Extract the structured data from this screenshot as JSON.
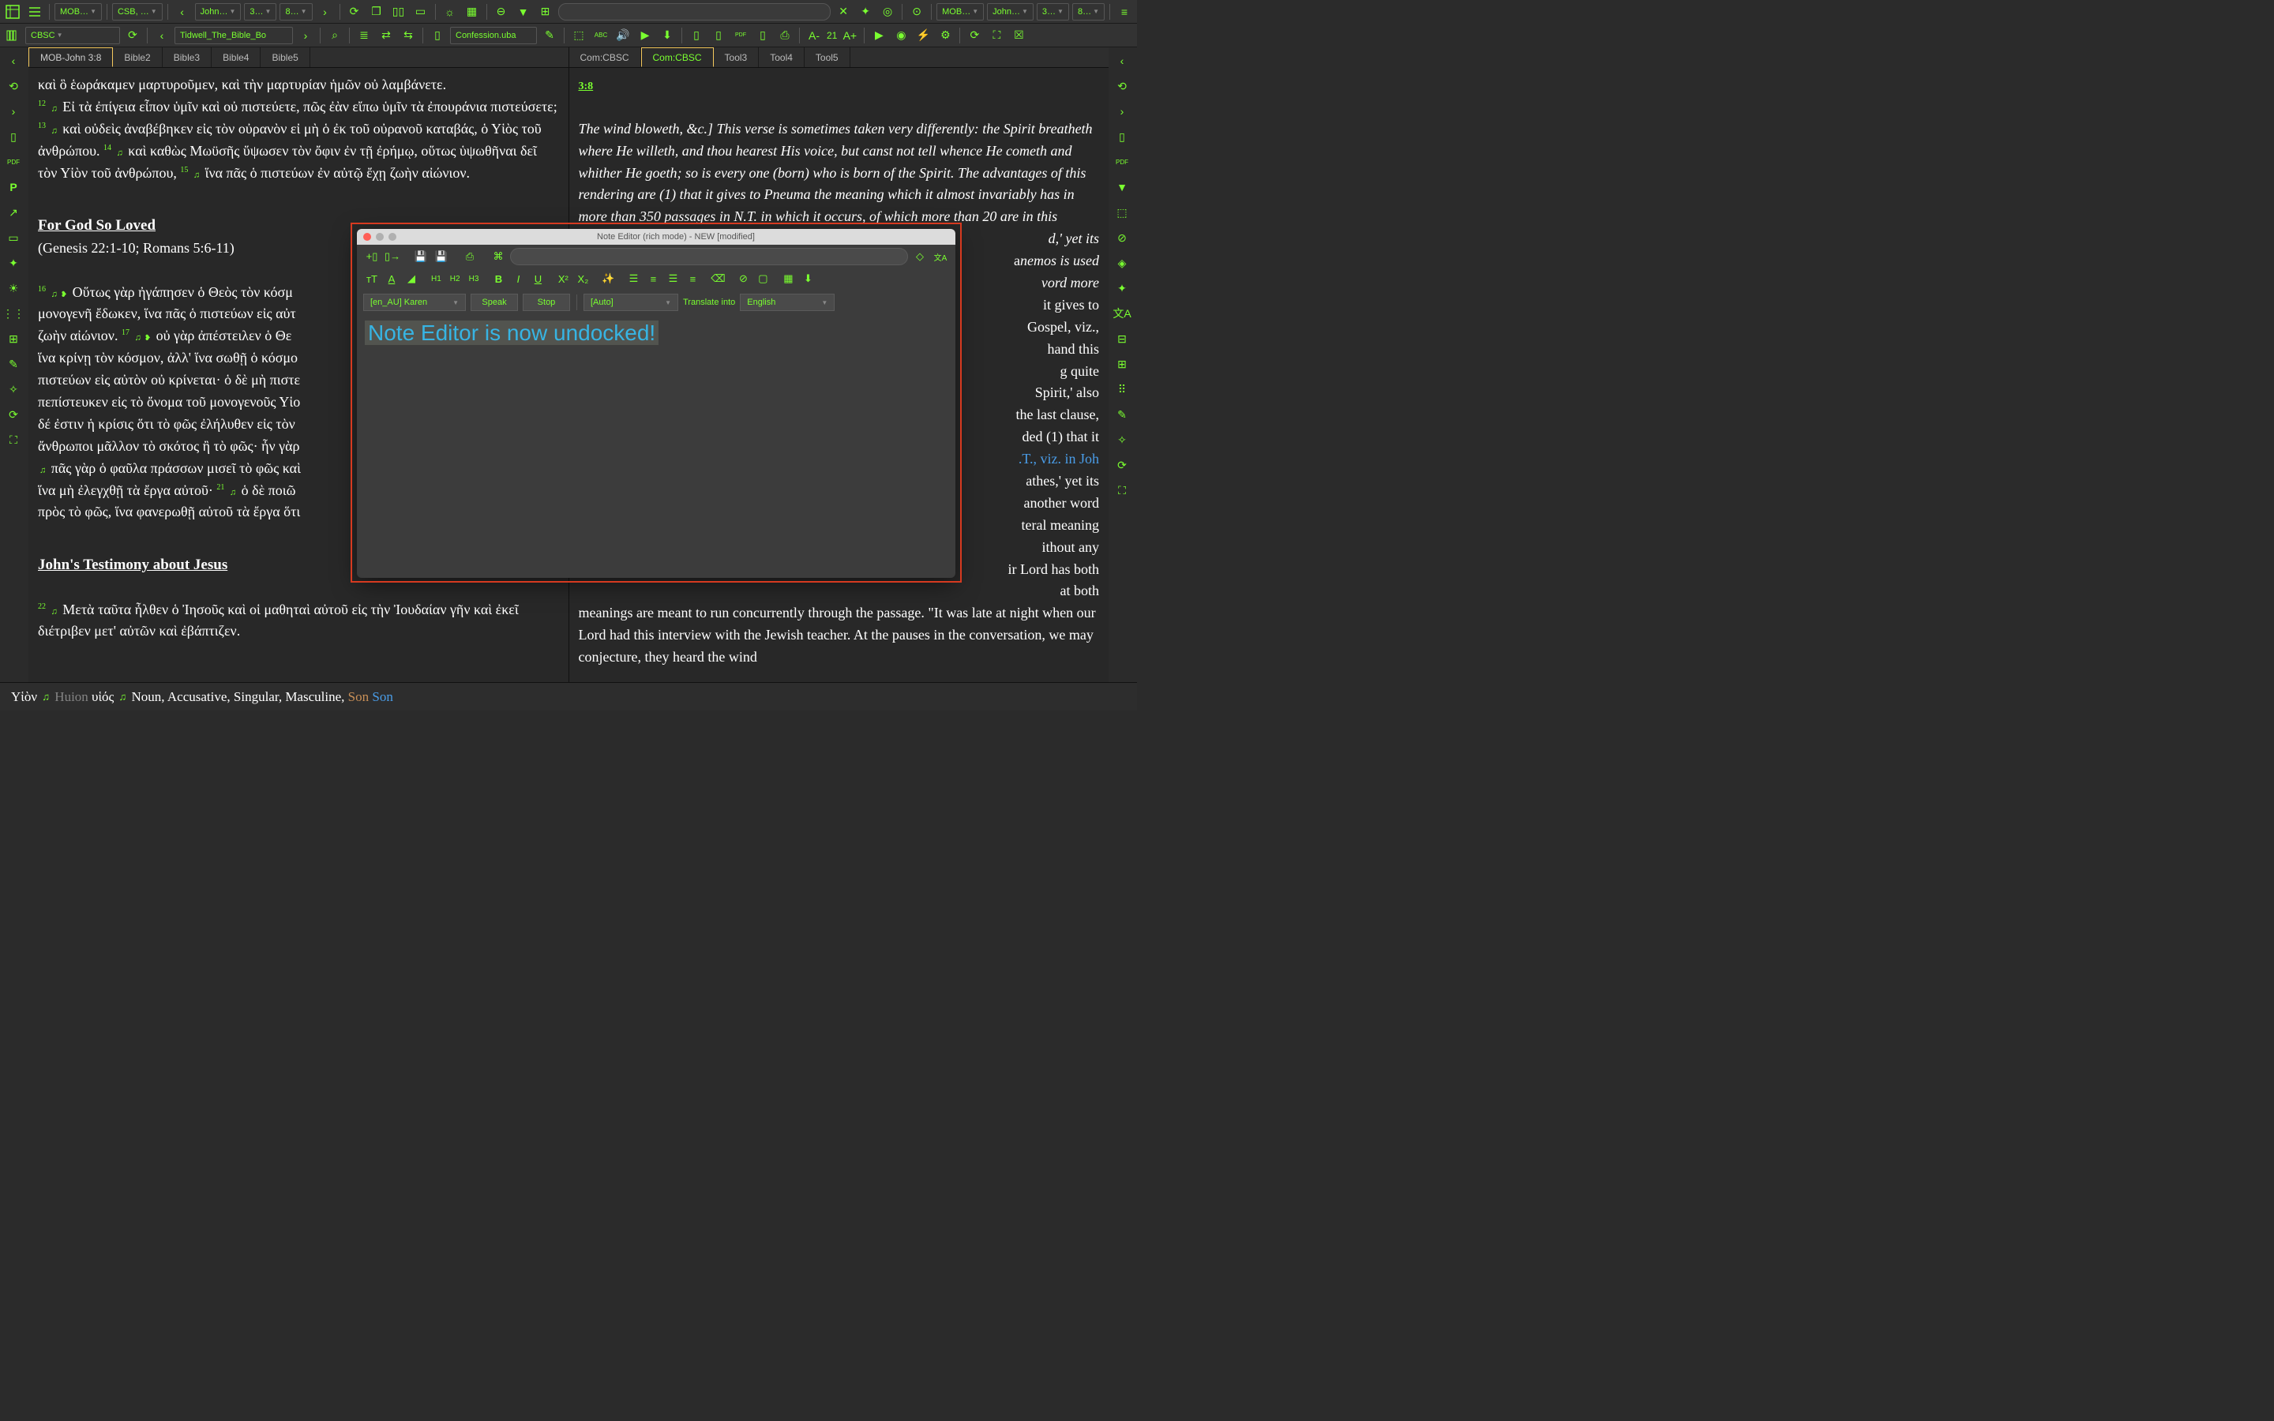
{
  "top": {
    "module1": "MOB…",
    "module2": "CSB, …",
    "nav_book": "John…",
    "nav_chap": "3…",
    "nav_verse": "8…",
    "right_mod": "MOB…",
    "right_book": "John…",
    "right_chap": "3…",
    "right_verse": "8…"
  },
  "second": {
    "dropdown": "CBSC",
    "book_file": "Tidwell_The_Bible_Bo",
    "file": "Confession.uba",
    "zoom": "21"
  },
  "left_tabs": [
    "MOB-John 3:8",
    "Bible2",
    "Bible3",
    "Bible4",
    "Bible5"
  ],
  "right_tabs": [
    "Com:CBSC",
    "Com:CBSC",
    "Tool3",
    "Tool4",
    "Tool5"
  ],
  "left_content": {
    "greek1": "καὶ ὃ ἑωράκαμεν μαρτυροῦμεν, καὶ τὴν μαρτυρίαν ἡμῶν οὐ λαμβάνετε.",
    "v12": "12",
    "greek2": "Εἰ τὰ ἐπίγεια εἶπον ὑμῖν καὶ οὐ πιστεύετε, πῶς ἐὰν εἴπω ὑμῖν τὰ ἐπουράνια πιστεύσετε;",
    "v13": "13",
    "greek3": "καὶ οὐδεὶς ἀναβέβηκεν εἰς τὸν οὐρανὸν εἰ μὴ ὁ ἐκ τοῦ οὐρανοῦ καταβάς, ὁ Υἱὸς τοῦ ἀνθρώπου.",
    "v14": "14",
    "greek4": "καὶ καθὼς Μωϋσῆς ὕψωσεν τὸν ὄφιν ἐν τῇ ἐρήμῳ, οὕτως ὑψωθῆναι δεῖ τὸν Υἱὸν τοῦ ἀνθρώπου,",
    "v15": "15",
    "greek5": "ἵνα πᾶς ὁ πιστεύων ἐν αὐτῷ ἔχῃ ζωὴν αἰώνιον.",
    "heading1": "For God So Loved",
    "xrefs": "(Genesis 22:1-10; Romans 5:6-11)",
    "v16": "16",
    "greek6": "Οὕτως γὰρ ἠγάπησεν ὁ Θεὸς τὸν κόσμ",
    "greek6b": "μονογενῆ ἔδωκεν, ἵνα πᾶς ὁ πιστεύων εἰς αὐτ",
    "greek6c": "ζωὴν αἰώνιον.",
    "v17": "17",
    "greek7": "οὐ γὰρ ἀπέστειλεν ὁ Θε",
    "greek7b": "ἵνα κρίνῃ τὸν κόσμον, ἀλλ' ἵνα σωθῇ ὁ κόσμο",
    "greek7c": "πιστεύων εἰς αὐτὸν οὐ κρίνεται· ὁ δὲ μὴ πιστε",
    "greek7d": "πεπίστευκεν εἰς τὸ ὄνομα τοῦ μονογενοῦς Υἱο",
    "greek7e": "δέ ἐστιν ἡ κρίσις ὅτι τὸ φῶς ἐλήλυθεν εἰς τὸν",
    "greek7f": "ἄνθρωποι μᾶλλον τὸ σκότος ἢ τὸ φῶς· ἦν γὰρ",
    "greek8": "πᾶς γὰρ ὁ φαῦλα πράσσων μισεῖ τὸ φῶς καὶ",
    "greek8b": "ἵνα μὴ ἐλεγχθῇ τὰ ἔργα αὐτοῦ·",
    "v21": "21",
    "greek9": "ὁ δὲ ποιῶ",
    "greek9b": "πρὸς τὸ φῶς, ἵνα φανερωθῇ αὐτοῦ τὰ ἔργα ὅτι",
    "heading2": "John's Testimony about Jesus",
    "v22": "22",
    "greek10": "Μετὰ ταῦτα ἦλθεν ὁ Ἰησοῦς καὶ οἱ μαθηταὶ αὐτοῦ εἰς τὴν Ἰουδαίαν γῆν καὶ ἐκεῖ διέτριβεν μετ' αὐτῶν καὶ ἐβάπτιζεν."
  },
  "right_content": {
    "ref": "3:8",
    "para": "The wind bloweth, &c.] This verse is sometimes taken very differently: the Spirit breatheth where He willeth, and thou hearest His voice, but canst not tell whence He cometh and whither He goeth; so is every one (born) who is born of the Spirit. The advantages of this rendering are (1) that it gives to Pneuma the meaning which it almost invariably has in more than 350 passages in N.T. in which it occurs, of which more than 20 are in this",
    "para_cont_a": "d,' yet its",
    "para_cont_b": "nemos is used",
    "para_cont_c": "vord more",
    "para_cont_d": "it gives to",
    "para_cont_e": "Gospel, viz.,",
    "para_cont_f": "hand this",
    "para_cont_g": "g quite",
    "para_cont_h": "Spirit,' also",
    "para_cont_i": "the last clause,",
    "para_cont_j": "ded (1) that it",
    "para_cont_k": ".T., viz. in Joh",
    "para_cont_l": "athes,' yet its",
    "para_cont_m": "another word",
    "para_cont_n": "teral meaning",
    "para_cont_o": "ithout any",
    "para_cont_p": "ir Lord has both",
    "para_cont_q": "at both",
    "para_bottom": "meanings are meant to run concurrently through the passage. \"It was late at night when our Lord had this interview with the Jewish teacher. At the pauses in the conversation, we may conjecture, they heard the wind"
  },
  "note_editor": {
    "title": "Note Editor (rich mode) - NEW [modified]",
    "h1": "H1",
    "h2": "H2",
    "h3": "H3",
    "lang": "[en_AU] Karen",
    "speak": "Speak",
    "stop": "Stop",
    "auto": "[Auto]",
    "trans_label": "Translate into",
    "trans_lang": "English",
    "body": "Note Editor is now undocked!"
  },
  "bottom": {
    "t1": "Υἱὸν",
    "t2": "Huion",
    "t3": "υἱός",
    "morph": "Noun, Accusative, Singular, Masculine,",
    "gloss1": "Son",
    "gloss2": "Son"
  }
}
